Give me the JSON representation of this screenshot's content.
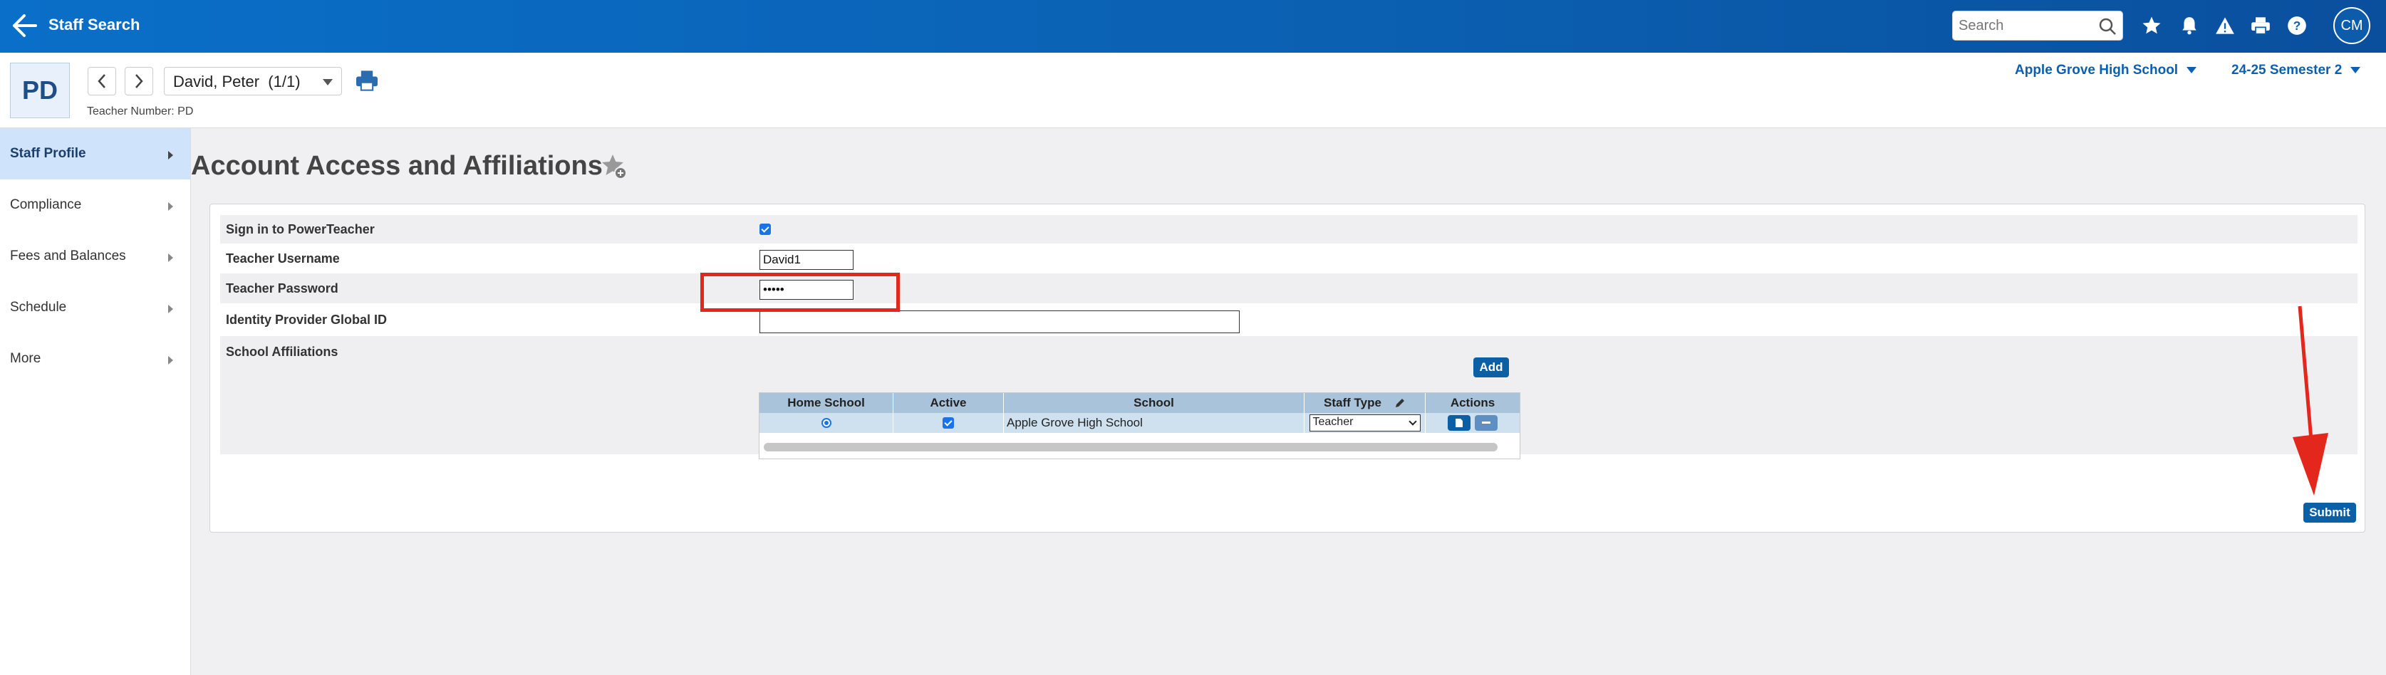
{
  "topbar": {
    "title": "Staff Search",
    "search_placeholder": "Search",
    "avatar_initials": "CM"
  },
  "header": {
    "initials": "PD",
    "staff_name": "David, Peter  (1/1)",
    "teacher_number": "Teacher Number: PD",
    "school": "Apple Grove High School",
    "term": "24-25 Semester 2"
  },
  "sidebar": {
    "items": [
      {
        "label": "Staff Profile",
        "active": true
      },
      {
        "label": "Compliance"
      },
      {
        "label": "Fees and Balances"
      },
      {
        "label": "Schedule"
      },
      {
        "label": "More"
      }
    ]
  },
  "page": {
    "title": "Account Access and Affiliations"
  },
  "form": {
    "signin_label": "Sign in to PowerTeacher",
    "signin_checked": true,
    "username_label": "Teacher Username",
    "username_value": "David1",
    "password_label": "Teacher Password",
    "password_value": "•••••",
    "idp_label": "Identity Provider Global ID",
    "idp_value": "",
    "affiliations_label": "School Affiliations",
    "add_label": "Add",
    "submit_label": "Submit"
  },
  "affiliations": {
    "headers": [
      "Home School",
      "Active",
      "School",
      "Staff Type",
      "Actions"
    ],
    "rows": [
      {
        "home_school": true,
        "active": true,
        "school": "Apple Grove High School",
        "staff_type": "Teacher"
      }
    ]
  },
  "colors": {
    "brand_blue": "#0b5fb0",
    "highlight_red": "#e3271c"
  }
}
